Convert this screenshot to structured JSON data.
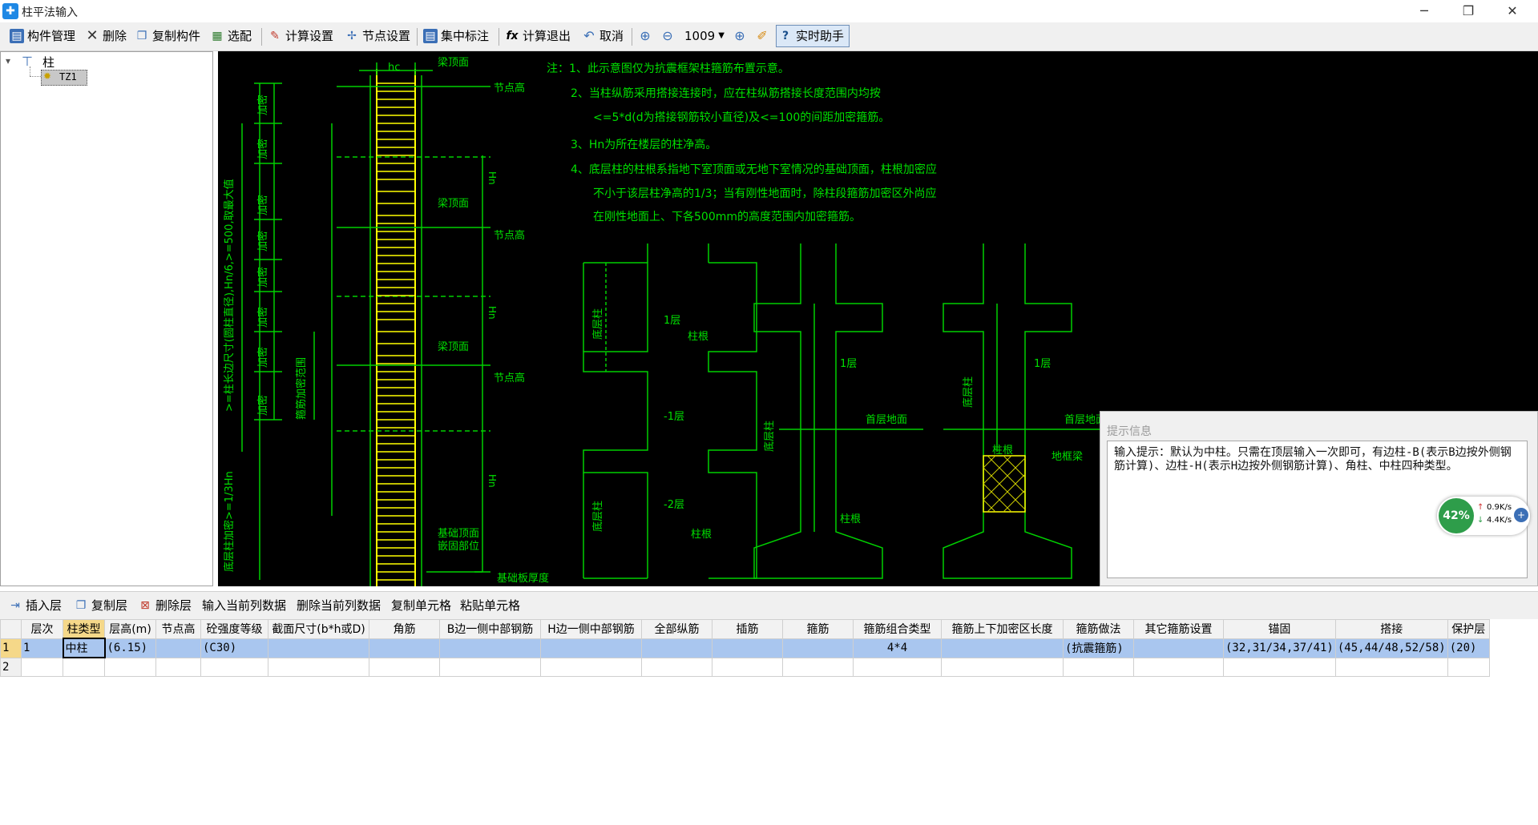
{
  "window": {
    "title": "柱平法输入",
    "controls": [
      "─",
      "❐",
      "✕"
    ]
  },
  "toolbar": {
    "items": [
      {
        "label": "构件管理",
        "icon": "component-manager-icon"
      },
      {
        "label": "删除",
        "icon": "delete-x-icon"
      },
      {
        "label": "复制构件",
        "icon": "copy-component-icon"
      },
      {
        "label": "选配",
        "icon": "select-config-icon"
      },
      {
        "label": "计算设置",
        "icon": "calc-settings-icon"
      },
      {
        "label": "节点设置",
        "icon": "node-settings-icon"
      },
      {
        "label": "集中标注",
        "icon": "annotation-icon"
      },
      {
        "label": "计算退出",
        "icon": "calc-exit-icon"
      },
      {
        "label": "取消",
        "icon": "undo-icon"
      }
    ],
    "zoom_value": "1009",
    "assistant_label": "实时助手"
  },
  "tree": {
    "root": "柱",
    "child": "TZ1"
  },
  "drawing": {
    "notes": [
      "注：1、此示意图仅为抗震框架柱箍筋布置示意。",
      "2、当柱纵筋采用搭接连接时，应在柱纵筋搭接长度范围内均按",
      "<=5*d(d为搭接钢筋较小直径)及<=100的间距加密箍筋。",
      "3、Hn为所在楼层的柱净高。",
      "4、底层柱的柱根系指地下室顶面或无地下室情况的基础顶面，柱根加密应",
      "不小于该层柱净高的1/3；当有刚性地面时，除柱段箍筋加密区外尚应",
      "在刚性地面上、下各500mm的高度范围内加密箍筋。"
    ],
    "labels": {
      "hc": "hc",
      "beam_top": "梁顶面",
      "node_height": "节点高",
      "dense": "加密",
      "hn": "Hn",
      "left_vertical": ">=柱长边尺寸(圆柱直径),Hn/6,>=500,取最大值",
      "stirrup_range": "箍筋加密范围",
      "base_dense": "底层柱加密>=1/3Hn",
      "foundation_top": "基础顶面",
      "embed": "嵌固部位",
      "slab_thickness": "基础板厚度",
      "bottom_col": "底层柱",
      "floor1": "1层",
      "floor_m1": "-1层",
      "floor_m2": "-2层",
      "col_root": "柱根",
      "ground": "首层地面",
      "ground_beam": "地框梁"
    }
  },
  "hint": {
    "title": "提示信息",
    "text": "输入提示：默认为中柱。只需在顶层输入一次即可，有边柱-B(表示B边按外侧钢筋计算)、边柱-H(表示H边按外侧钢筋计算)、角柱、中柱四种类型。"
  },
  "net_widget": {
    "percent": "42%",
    "up": "0.9K/s",
    "down": "4.4K/s"
  },
  "bottom_toolbar": [
    {
      "label": "插入层",
      "icon": "insert-layer-icon"
    },
    {
      "label": "复制层",
      "icon": "copy-layer-icon"
    },
    {
      "label": "删除层",
      "icon": "delete-layer-icon"
    },
    {
      "label": "输入当前列数据",
      "icon": ""
    },
    {
      "label": "删除当前列数据",
      "icon": ""
    },
    {
      "label": "复制单元格",
      "icon": ""
    },
    {
      "label": "粘贴单元格",
      "icon": ""
    }
  ],
  "table": {
    "columns": [
      "",
      "层次",
      "柱类型",
      "层高(m)",
      "节点高",
      "砼强度等级",
      "截面尺寸(b*h或D)",
      "角筋",
      "B边一侧中部钢筋",
      "H边一侧中部钢筋",
      "全部纵筋",
      "插筋",
      "箍筋",
      "箍筋组合类型",
      "箍筋上下加密区长度",
      "箍筋做法",
      "其它箍筋设置",
      "锚固",
      "搭接",
      "保护层"
    ],
    "rows": [
      [
        "1",
        "1",
        "中柱",
        "(6.15)",
        "",
        "(C30)",
        "",
        "",
        "",
        "",
        "",
        "",
        "",
        "4*4",
        "",
        "(抗震箍筋)",
        "",
        "(32,31/34,37/41)",
        "(45,44/48,52/58)",
        "(20)"
      ],
      [
        "2",
        "",
        "",
        "",
        "",
        "",
        "",
        "",
        "",
        "",
        "",
        "",
        "",
        "",
        "",
        "",
        "",
        "",
        "",
        ""
      ]
    ]
  }
}
